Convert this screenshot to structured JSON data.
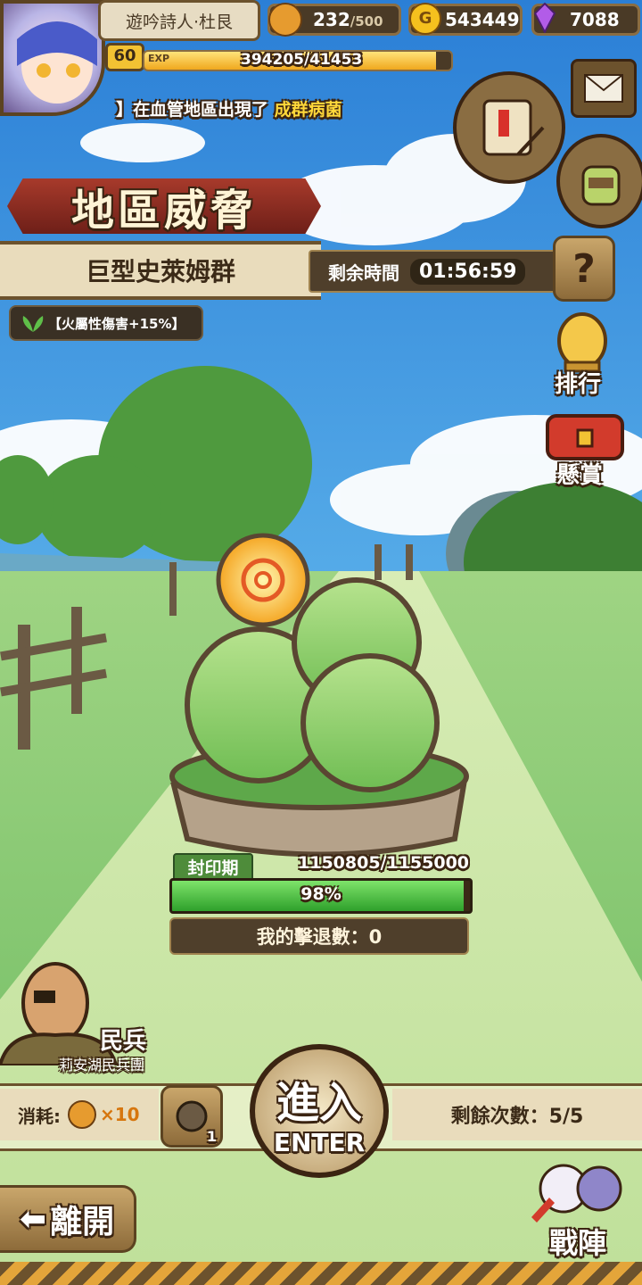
{
  "player": {
    "name": "遊吟詩人·杜艮",
    "level": "60",
    "exp_label": "EXP",
    "exp_text": "394205/41453",
    "exp_fraction": 0.95
  },
  "resources": {
    "bread_current": "232",
    "bread_max": "/500",
    "gold": "543449",
    "gems": "7088"
  },
  "news": {
    "prefix": "】在血管地區出現了",
    "highlight": "成群病菌"
  },
  "event": {
    "banner_title": "地區威脅",
    "boss_name": "巨型史萊姆群",
    "time_label": "剩余時間",
    "time_value": "01:56:59",
    "help_glyph": "?",
    "buff_text": "【火屬性傷害+15%】"
  },
  "side_buttons": {
    "ranking_label": "排行",
    "reward_label": "懸賞"
  },
  "boss_status": {
    "phase_label": "封印期",
    "hp_text": "1150805/1155000",
    "percent_text": "98%",
    "progress_fraction": 0.98,
    "my_kills_text": "我的擊退數：0"
  },
  "npc": {
    "name": "民兵",
    "group": "莉安湖民兵團"
  },
  "bottom": {
    "cost_label": "消耗:",
    "cost_multiplier": "×10",
    "ticket_count": "1",
    "enter_cn": "進入",
    "enter_en": "ENTER",
    "remaining_text": "剩餘次數：5/5",
    "leave_label": "離開",
    "formation_label": "戰陣"
  },
  "colors": {
    "accent_gold": "#f2c233",
    "banner_red": "#8e2a20",
    "progress_green": "#3bb236",
    "highlight_yellow": "#ffd83a"
  }
}
